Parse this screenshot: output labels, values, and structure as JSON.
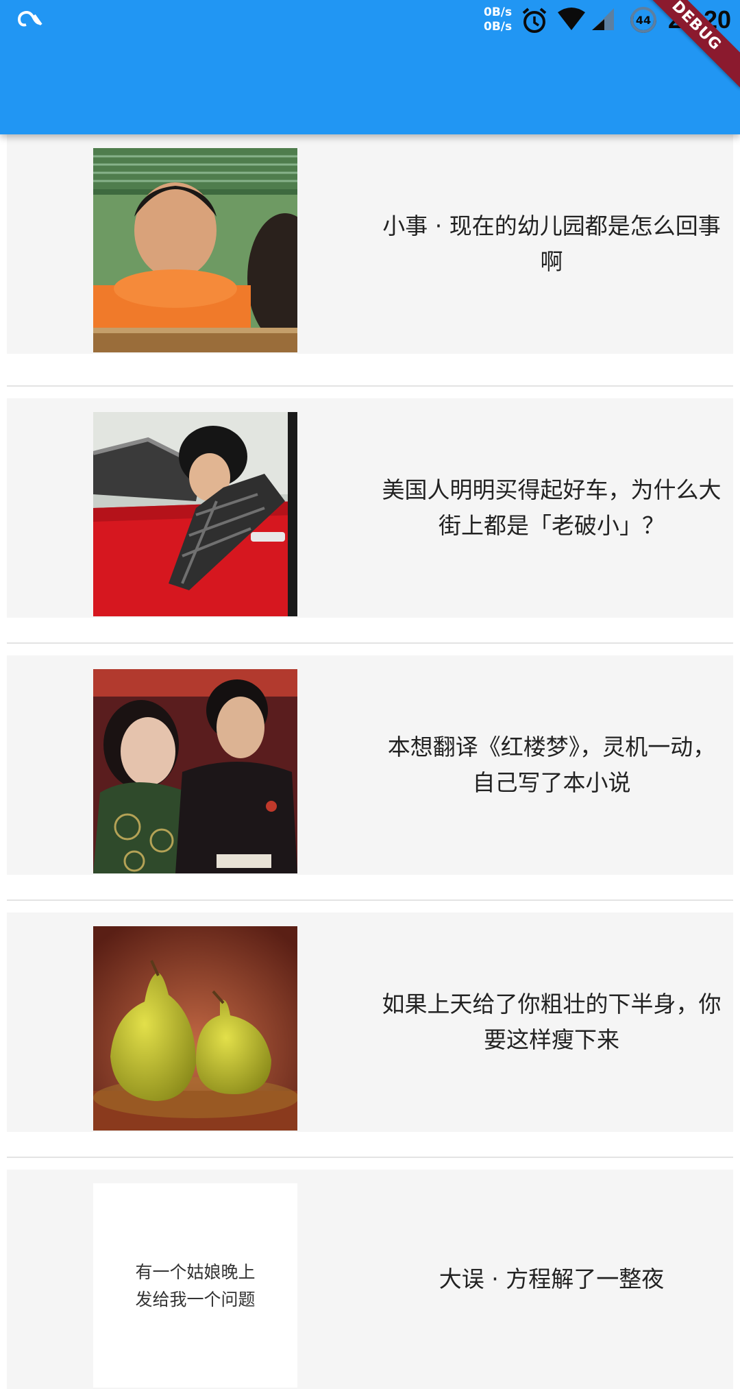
{
  "status_bar": {
    "speed_up": "0B/s",
    "speed_down": "0B/s",
    "battery": "44",
    "time": "20:20",
    "icons": [
      "cast-icon",
      "alarm-icon",
      "wifi-icon",
      "signal-icon",
      "battery-icon"
    ]
  },
  "debug_banner": "DEBUG",
  "colors": {
    "app_bar": "#2196F3",
    "card_bg": "#f5f5f5",
    "debug": "#8b1a2e"
  },
  "items": [
    {
      "title": "小事 · 现在的幼儿园都是怎么回事啊",
      "image": "boy-orange-shirt"
    },
    {
      "title": "美国人明明买得起好车，为什么大街上都是「老破小」？",
      "image": "man-red-car"
    },
    {
      "title": "本想翻译《红楼梦》，灵机一动，自己写了本小说",
      "image": "couple-portrait"
    },
    {
      "title": "如果上天给了你粗壮的下半身，你要这样瘦下来",
      "image": "two-pears"
    },
    {
      "title": "大误 · 方程解了一整夜",
      "image": "text-card",
      "image_text": [
        "有一个姑娘晚上",
        "发给我一个问题"
      ]
    }
  ]
}
